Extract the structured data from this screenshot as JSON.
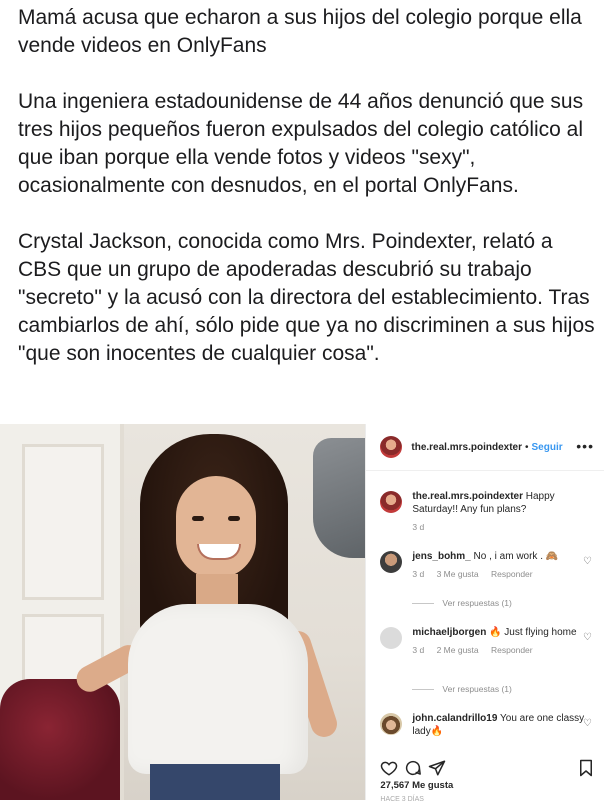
{
  "article": {
    "headline": "Mamá acusa que echaron a sus hijos del colegio porque ella vende videos en OnlyFans",
    "paragraph1": "Una ingeniera estadounidense de 44 años denunció que sus tres hijos pequeños fueron expulsados del colegio católico al que iban porque ella vende fotos y videos \"sexy\", ocasionalmente con desnudos, en el portal OnlyFans.",
    "paragraph2": "Crystal Jackson, conocida como Mrs. Poindexter, relató a CBS que un grupo de apoderadas descubrió su trabajo \"secreto\" y la acusó con la directora del establecimiento. Tras cambiarlos de ahí, sólo pide que ya no discriminen a sus hijos \"que son inocentes de cualquier cosa\"."
  },
  "post": {
    "header": {
      "username": "the.real.mrs.poindexter",
      "dot": "•",
      "follow": "Seguir",
      "more": "•••"
    },
    "caption": {
      "username": "the.real.mrs.poindexter",
      "text": "Happy Saturday!! Any fun plans?",
      "age": "3 d"
    },
    "comments": [
      {
        "username": "jens_bohm_",
        "text": "No , i am work . 🙈",
        "age": "3 d",
        "likes": "3 Me gusta",
        "reply": "Responder",
        "view_replies": "Ver respuestas (1)"
      },
      {
        "username": "michaeljborgen",
        "text": "🔥 Just flying home",
        "age": "3 d",
        "likes": "2 Me gusta",
        "reply": "Responder",
        "view_replies": "Ver respuestas (1)"
      },
      {
        "username": "john.calandrillo19",
        "text": "You are one classy lady🔥"
      }
    ],
    "icons": {
      "like": "heart-icon",
      "comment": "comment-icon",
      "share": "share-icon",
      "save": "bookmark-icon"
    },
    "likes_count": "27,567 Me gusta",
    "posted": "HACE 3 DÍAS"
  }
}
